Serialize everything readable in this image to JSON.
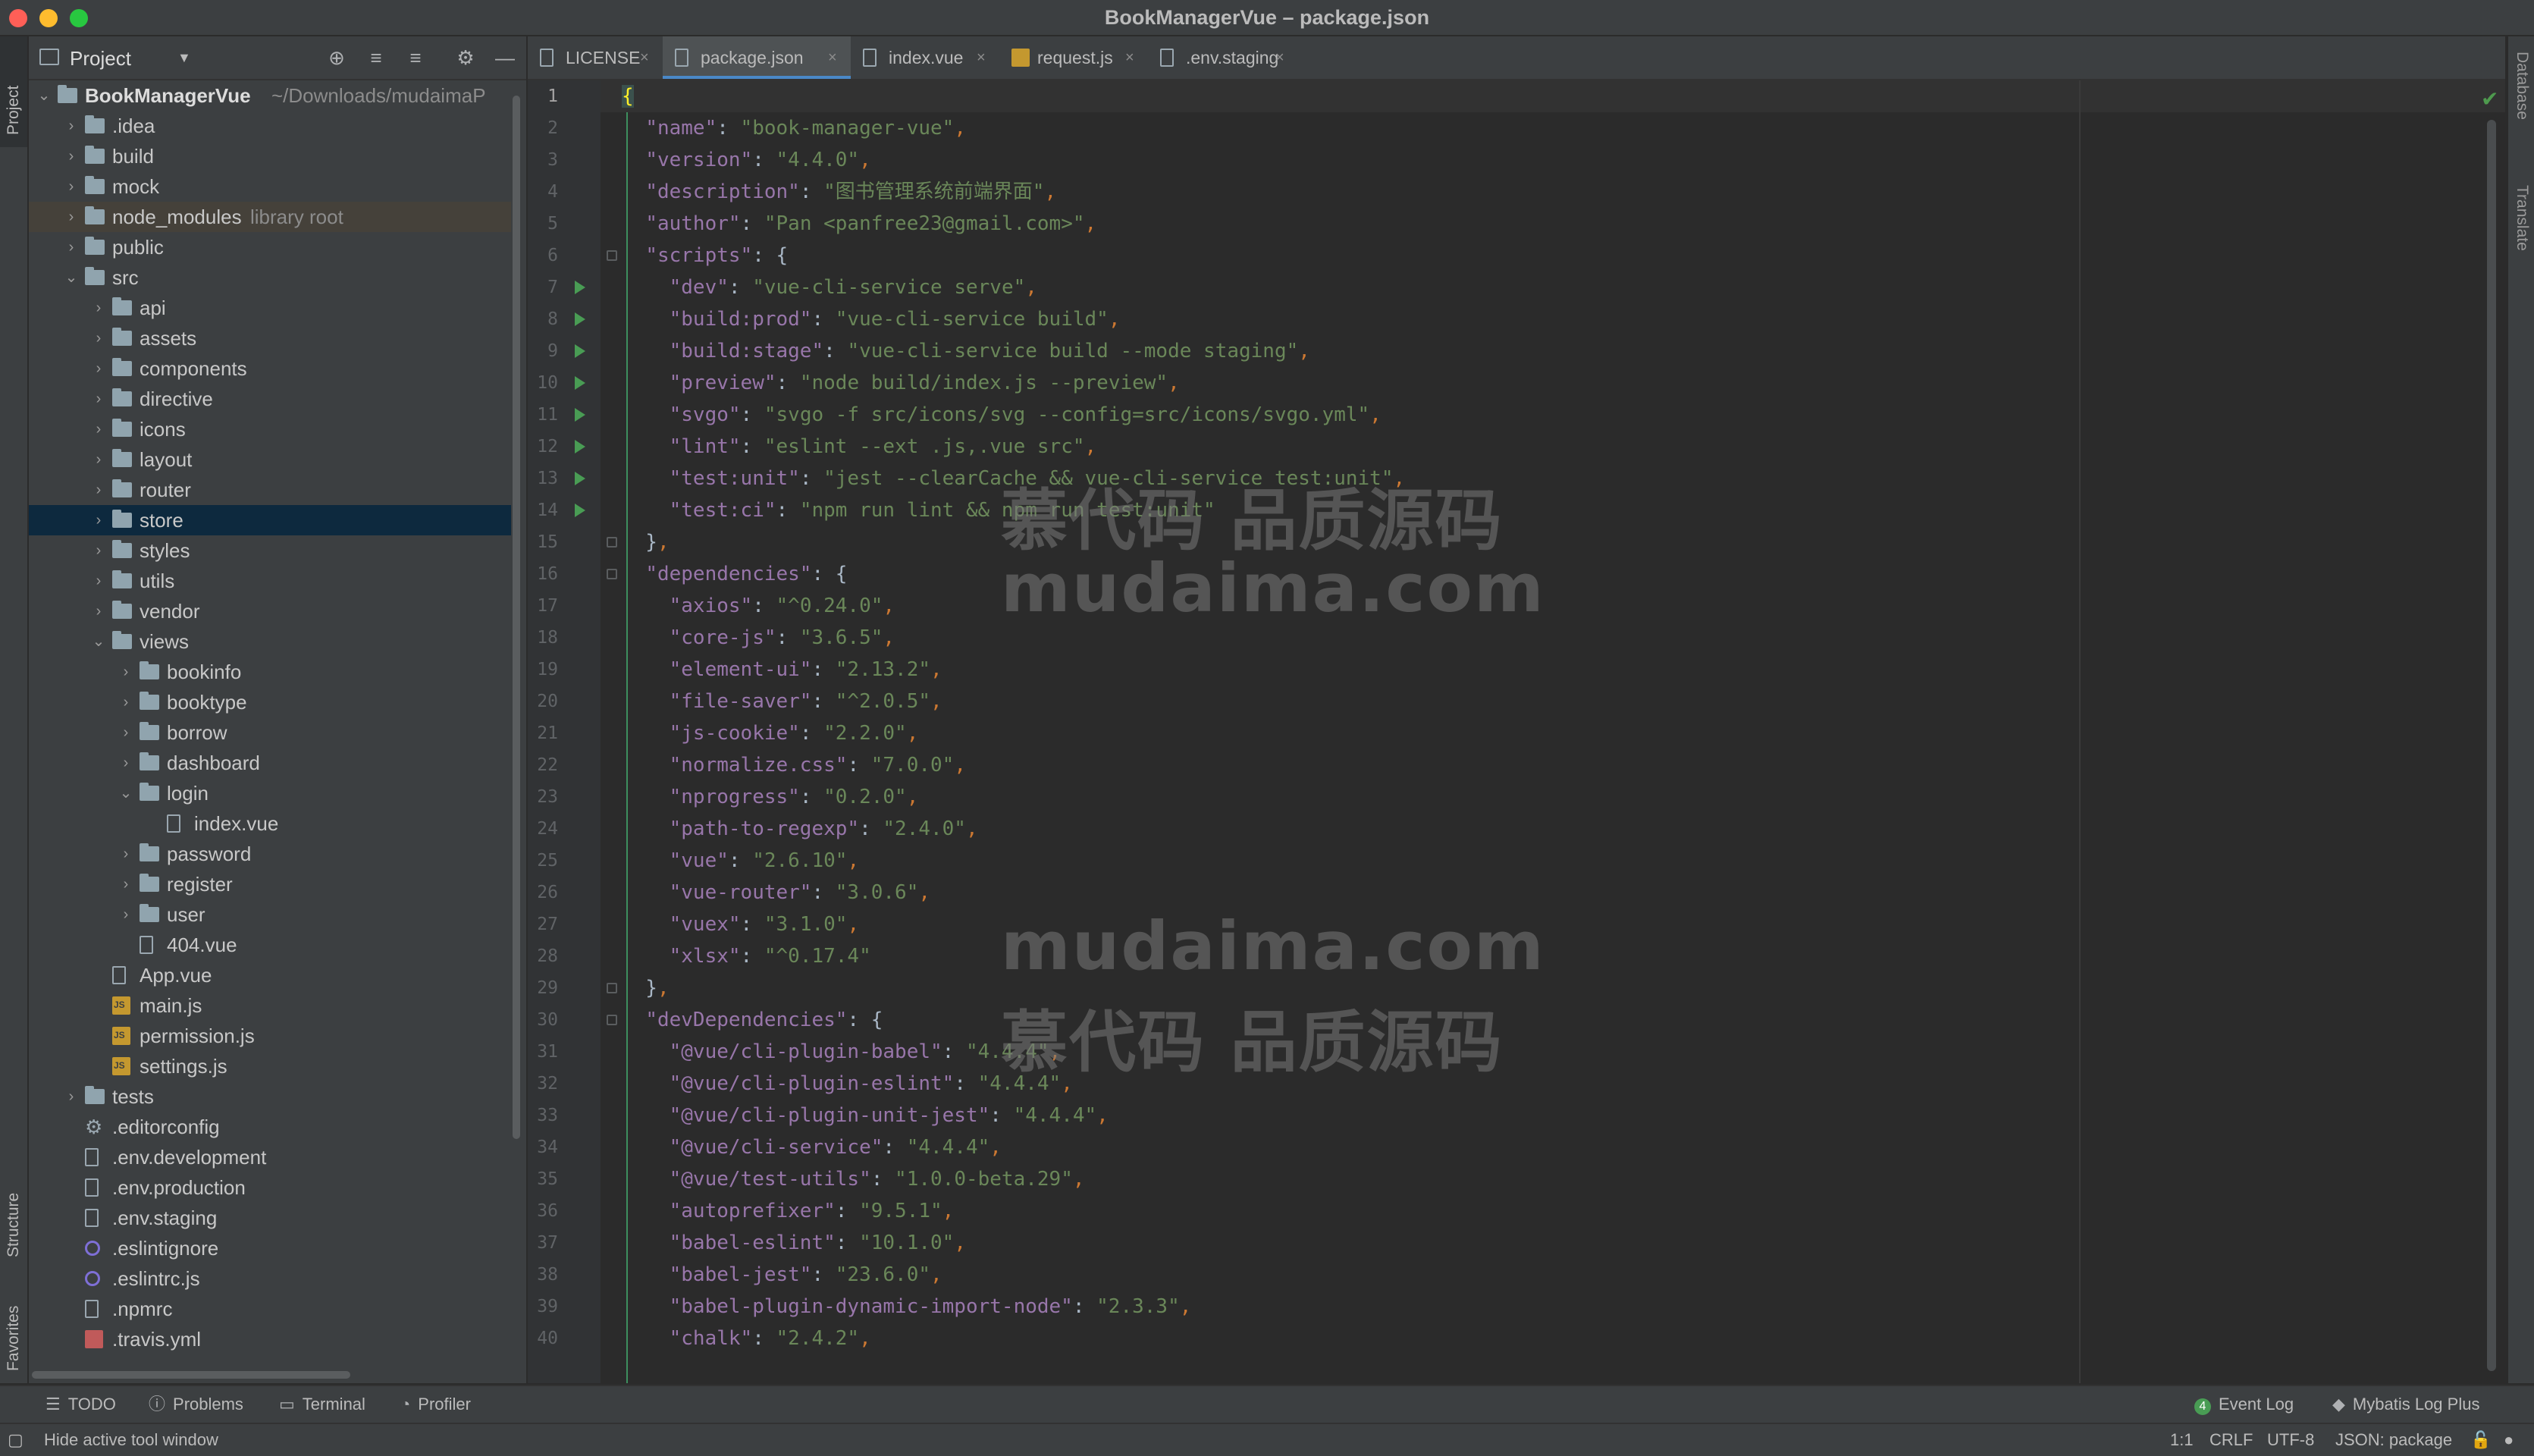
{
  "window": {
    "title": "BookManagerVue – package.json"
  },
  "left_strip": {
    "project_label": "Project",
    "structure_label": "Structure",
    "favorites_label": "Favorites"
  },
  "right_strip": {
    "database_label": "Database",
    "translate_label": "Translate"
  },
  "project_panel": {
    "title": "Project",
    "tree": [
      {
        "name": "BookManagerVue",
        "hint": "~/Downloads/mudaimaP",
        "depth": 0,
        "type": "folder",
        "expanded": true,
        "root": true
      },
      {
        "name": ".idea",
        "depth": 1,
        "type": "folder",
        "expanded": false
      },
      {
        "name": "build",
        "depth": 1,
        "type": "folder",
        "expanded": false
      },
      {
        "name": "mock",
        "depth": 1,
        "type": "folder",
        "expanded": false
      },
      {
        "name": "node_modules",
        "hint": "library root",
        "depth": 1,
        "type": "folder",
        "expanded": false,
        "highlight": true
      },
      {
        "name": "public",
        "depth": 1,
        "type": "folder",
        "expanded": false
      },
      {
        "name": "src",
        "depth": 1,
        "type": "folder",
        "expanded": true
      },
      {
        "name": "api",
        "depth": 2,
        "type": "folder",
        "expanded": false
      },
      {
        "name": "assets",
        "depth": 2,
        "type": "folder",
        "expanded": false
      },
      {
        "name": "components",
        "depth": 2,
        "type": "folder",
        "expanded": false
      },
      {
        "name": "directive",
        "depth": 2,
        "type": "folder",
        "expanded": false
      },
      {
        "name": "icons",
        "depth": 2,
        "type": "folder",
        "expanded": false
      },
      {
        "name": "layout",
        "depth": 2,
        "type": "folder",
        "expanded": false
      },
      {
        "name": "router",
        "depth": 2,
        "type": "folder",
        "expanded": false
      },
      {
        "name": "store",
        "depth": 2,
        "type": "folder",
        "expanded": false,
        "selected": true
      },
      {
        "name": "styles",
        "depth": 2,
        "type": "folder",
        "expanded": false
      },
      {
        "name": "utils",
        "depth": 2,
        "type": "folder",
        "expanded": false
      },
      {
        "name": "vendor",
        "depth": 2,
        "type": "folder",
        "expanded": false
      },
      {
        "name": "views",
        "depth": 2,
        "type": "folder",
        "expanded": true
      },
      {
        "name": "bookinfo",
        "depth": 3,
        "type": "folder",
        "expanded": false
      },
      {
        "name": "booktype",
        "depth": 3,
        "type": "folder",
        "expanded": false
      },
      {
        "name": "borrow",
        "depth": 3,
        "type": "folder",
        "expanded": false
      },
      {
        "name": "dashboard",
        "depth": 3,
        "type": "folder",
        "expanded": false
      },
      {
        "name": "login",
        "depth": 3,
        "type": "folder",
        "expanded": true
      },
      {
        "name": "index.vue",
        "depth": 4,
        "type": "file"
      },
      {
        "name": "password",
        "depth": 3,
        "type": "folder",
        "expanded": false
      },
      {
        "name": "register",
        "depth": 3,
        "type": "folder",
        "expanded": false
      },
      {
        "name": "user",
        "depth": 3,
        "type": "folder",
        "expanded": false
      },
      {
        "name": "404.vue",
        "depth": 3,
        "type": "file"
      },
      {
        "name": "App.vue",
        "depth": 2,
        "type": "file"
      },
      {
        "name": "main.js",
        "depth": 2,
        "type": "js"
      },
      {
        "name": "permission.js",
        "depth": 2,
        "type": "js"
      },
      {
        "name": "settings.js",
        "depth": 2,
        "type": "js"
      },
      {
        "name": "tests",
        "depth": 1,
        "type": "folder",
        "expanded": false
      },
      {
        "name": ".editorconfig",
        "depth": 1,
        "type": "gear"
      },
      {
        "name": ".env.development",
        "depth": 1,
        "type": "file"
      },
      {
        "name": ".env.production",
        "depth": 1,
        "type": "file"
      },
      {
        "name": ".env.staging",
        "depth": 1,
        "type": "file"
      },
      {
        "name": ".eslintignore",
        "depth": 1,
        "type": "ring"
      },
      {
        "name": ".eslintrc.js",
        "depth": 1,
        "type": "ring"
      },
      {
        "name": ".npmrc",
        "depth": 1,
        "type": "file"
      },
      {
        "name": ".travis.yml",
        "depth": 1,
        "type": "yml"
      }
    ]
  },
  "editor": {
    "tabs": [
      {
        "label": "LICENSE",
        "icon": "file-icon"
      },
      {
        "label": "package.json",
        "icon": "json-file-icon",
        "active": true
      },
      {
        "label": "index.vue",
        "icon": "file-icon"
      },
      {
        "label": "request.js",
        "icon": "js-file-icon"
      },
      {
        "label": ".env.staging",
        "icon": "file-icon"
      }
    ],
    "lines": [
      "{",
      "  \"name\": \"book-manager-vue\",",
      "  \"version\": \"4.4.0\",",
      "  \"description\": \"图书管理系统前端界面\",",
      "  \"author\": \"Pan <panfree23@gmail.com>\",",
      "  \"scripts\": {",
      "    \"dev\": \"vue-cli-service serve\",",
      "    \"build:prod\": \"vue-cli-service build\",",
      "    \"build:stage\": \"vue-cli-service build --mode staging\",",
      "    \"preview\": \"node build/index.js --preview\",",
      "    \"svgo\": \"svgo -f src/icons/svg --config=src/icons/svgo.yml\",",
      "    \"lint\": \"eslint --ext .js,.vue src\",",
      "    \"test:unit\": \"jest --clearCache && vue-cli-service test:unit\",",
      "    \"test:ci\": \"npm run lint && npm run test:unit\"",
      "  },",
      "  \"dependencies\": {",
      "    \"axios\": \"^0.24.0\",",
      "    \"core-js\": \"3.6.5\",",
      "    \"element-ui\": \"2.13.2\",",
      "    \"file-saver\": \"^2.0.5\",",
      "    \"js-cookie\": \"2.2.0\",",
      "    \"normalize.css\": \"7.0.0\",",
      "    \"nprogress\": \"0.2.0\",",
      "    \"path-to-regexp\": \"2.4.0\",",
      "    \"vue\": \"2.6.10\",",
      "    \"vue-router\": \"3.0.6\",",
      "    \"vuex\": \"3.1.0\",",
      "    \"xlsx\": \"^0.17.4\"",
      "  },",
      "  \"devDependencies\": {",
      "    \"@vue/cli-plugin-babel\": \"4.4.4\",",
      "    \"@vue/cli-plugin-eslint\": \"4.4.4\",",
      "    \"@vue/cli-plugin-unit-jest\": \"4.4.4\",",
      "    \"@vue/cli-service\": \"4.4.4\",",
      "    \"@vue/test-utils\": \"1.0.0-beta.29\",",
      "    \"autoprefixer\": \"9.5.1\",",
      "    \"babel-eslint\": \"10.1.0\",",
      "    \"babel-jest\": \"23.6.0\",",
      "    \"babel-plugin-dynamic-import-node\": \"2.3.3\",",
      "    \"chalk\": \"2.4.2\","
    ],
    "run_lines": [
      7,
      8,
      9,
      10,
      11,
      12,
      13,
      14
    ],
    "fold_lines": [
      1,
      6,
      15,
      16,
      29,
      30
    ]
  },
  "watermarks": {
    "top_cn": "慕代码 品质源码",
    "top_en": "mudaima.com",
    "bottom_en": "mudaima.com",
    "bottom_cn": "慕代码 品质源码"
  },
  "bottom_toolbar": {
    "todo": "TODO",
    "problems": "Problems",
    "terminal": "Terminal",
    "profiler": "Profiler",
    "event_log_count": "4",
    "event_log": "Event Log",
    "mybatis": "Mybatis Log Plus"
  },
  "status_bar": {
    "message": "Hide active tool window",
    "position": "1:1",
    "line_sep": "CRLF",
    "encoding": "UTF-8",
    "schema": "JSON: package"
  },
  "colors": {
    "selection": "#0d293e",
    "accent": "#4a88c7",
    "run": "#499c54"
  }
}
